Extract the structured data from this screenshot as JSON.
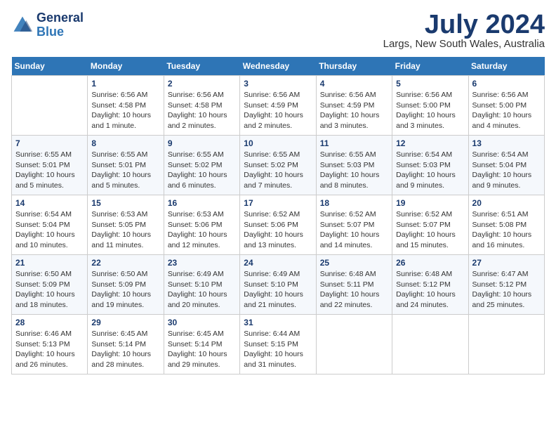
{
  "header": {
    "logo_line1": "General",
    "logo_line2": "Blue",
    "month": "July 2024",
    "location": "Largs, New South Wales, Australia"
  },
  "days_of_week": [
    "Sunday",
    "Monday",
    "Tuesday",
    "Wednesday",
    "Thursday",
    "Friday",
    "Saturday"
  ],
  "weeks": [
    [
      {
        "day": "",
        "info": ""
      },
      {
        "day": "1",
        "info": "Sunrise: 6:56 AM\nSunset: 4:58 PM\nDaylight: 10 hours\nand 1 minute."
      },
      {
        "day": "2",
        "info": "Sunrise: 6:56 AM\nSunset: 4:58 PM\nDaylight: 10 hours\nand 2 minutes."
      },
      {
        "day": "3",
        "info": "Sunrise: 6:56 AM\nSunset: 4:59 PM\nDaylight: 10 hours\nand 2 minutes."
      },
      {
        "day": "4",
        "info": "Sunrise: 6:56 AM\nSunset: 4:59 PM\nDaylight: 10 hours\nand 3 minutes."
      },
      {
        "day": "5",
        "info": "Sunrise: 6:56 AM\nSunset: 5:00 PM\nDaylight: 10 hours\nand 3 minutes."
      },
      {
        "day": "6",
        "info": "Sunrise: 6:56 AM\nSunset: 5:00 PM\nDaylight: 10 hours\nand 4 minutes."
      }
    ],
    [
      {
        "day": "7",
        "info": "Sunrise: 6:55 AM\nSunset: 5:01 PM\nDaylight: 10 hours\nand 5 minutes."
      },
      {
        "day": "8",
        "info": "Sunrise: 6:55 AM\nSunset: 5:01 PM\nDaylight: 10 hours\nand 5 minutes."
      },
      {
        "day": "9",
        "info": "Sunrise: 6:55 AM\nSunset: 5:02 PM\nDaylight: 10 hours\nand 6 minutes."
      },
      {
        "day": "10",
        "info": "Sunrise: 6:55 AM\nSunset: 5:02 PM\nDaylight: 10 hours\nand 7 minutes."
      },
      {
        "day": "11",
        "info": "Sunrise: 6:55 AM\nSunset: 5:03 PM\nDaylight: 10 hours\nand 8 minutes."
      },
      {
        "day": "12",
        "info": "Sunrise: 6:54 AM\nSunset: 5:03 PM\nDaylight: 10 hours\nand 9 minutes."
      },
      {
        "day": "13",
        "info": "Sunrise: 6:54 AM\nSunset: 5:04 PM\nDaylight: 10 hours\nand 9 minutes."
      }
    ],
    [
      {
        "day": "14",
        "info": "Sunrise: 6:54 AM\nSunset: 5:04 PM\nDaylight: 10 hours\nand 10 minutes."
      },
      {
        "day": "15",
        "info": "Sunrise: 6:53 AM\nSunset: 5:05 PM\nDaylight: 10 hours\nand 11 minutes."
      },
      {
        "day": "16",
        "info": "Sunrise: 6:53 AM\nSunset: 5:06 PM\nDaylight: 10 hours\nand 12 minutes."
      },
      {
        "day": "17",
        "info": "Sunrise: 6:52 AM\nSunset: 5:06 PM\nDaylight: 10 hours\nand 13 minutes."
      },
      {
        "day": "18",
        "info": "Sunrise: 6:52 AM\nSunset: 5:07 PM\nDaylight: 10 hours\nand 14 minutes."
      },
      {
        "day": "19",
        "info": "Sunrise: 6:52 AM\nSunset: 5:07 PM\nDaylight: 10 hours\nand 15 minutes."
      },
      {
        "day": "20",
        "info": "Sunrise: 6:51 AM\nSunset: 5:08 PM\nDaylight: 10 hours\nand 16 minutes."
      }
    ],
    [
      {
        "day": "21",
        "info": "Sunrise: 6:50 AM\nSunset: 5:09 PM\nDaylight: 10 hours\nand 18 minutes."
      },
      {
        "day": "22",
        "info": "Sunrise: 6:50 AM\nSunset: 5:09 PM\nDaylight: 10 hours\nand 19 minutes."
      },
      {
        "day": "23",
        "info": "Sunrise: 6:49 AM\nSunset: 5:10 PM\nDaylight: 10 hours\nand 20 minutes."
      },
      {
        "day": "24",
        "info": "Sunrise: 6:49 AM\nSunset: 5:10 PM\nDaylight: 10 hours\nand 21 minutes."
      },
      {
        "day": "25",
        "info": "Sunrise: 6:48 AM\nSunset: 5:11 PM\nDaylight: 10 hours\nand 22 minutes."
      },
      {
        "day": "26",
        "info": "Sunrise: 6:48 AM\nSunset: 5:12 PM\nDaylight: 10 hours\nand 24 minutes."
      },
      {
        "day": "27",
        "info": "Sunrise: 6:47 AM\nSunset: 5:12 PM\nDaylight: 10 hours\nand 25 minutes."
      }
    ],
    [
      {
        "day": "28",
        "info": "Sunrise: 6:46 AM\nSunset: 5:13 PM\nDaylight: 10 hours\nand 26 minutes."
      },
      {
        "day": "29",
        "info": "Sunrise: 6:45 AM\nSunset: 5:14 PM\nDaylight: 10 hours\nand 28 minutes."
      },
      {
        "day": "30",
        "info": "Sunrise: 6:45 AM\nSunset: 5:14 PM\nDaylight: 10 hours\nand 29 minutes."
      },
      {
        "day": "31",
        "info": "Sunrise: 6:44 AM\nSunset: 5:15 PM\nDaylight: 10 hours\nand 31 minutes."
      },
      {
        "day": "",
        "info": ""
      },
      {
        "day": "",
        "info": ""
      },
      {
        "day": "",
        "info": ""
      }
    ]
  ]
}
